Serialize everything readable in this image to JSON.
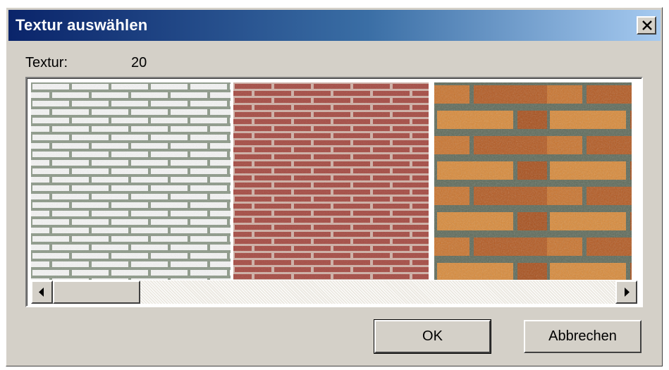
{
  "window": {
    "title": "Textur auswählen"
  },
  "texture": {
    "label": "Textur:",
    "value": "20"
  },
  "thumbnails": [
    {
      "name": "white-brick",
      "colors": {
        "brick": "#f4f4f4",
        "mortar": "#8e9a8a"
      }
    },
    {
      "name": "red-brick",
      "colors": {
        "brick": "#a54a42",
        "mortar": "#d0b0a6"
      }
    },
    {
      "name": "orange-brick",
      "colors": {
        "brick": "#c06a28",
        "mortar": "#5e6a5a"
      }
    }
  ],
  "buttons": {
    "ok": "OK",
    "cancel": "Abbrechen"
  },
  "icons": {
    "close": "close-icon",
    "scroll_left": "arrow-left-icon",
    "scroll_right": "arrow-right-icon"
  }
}
